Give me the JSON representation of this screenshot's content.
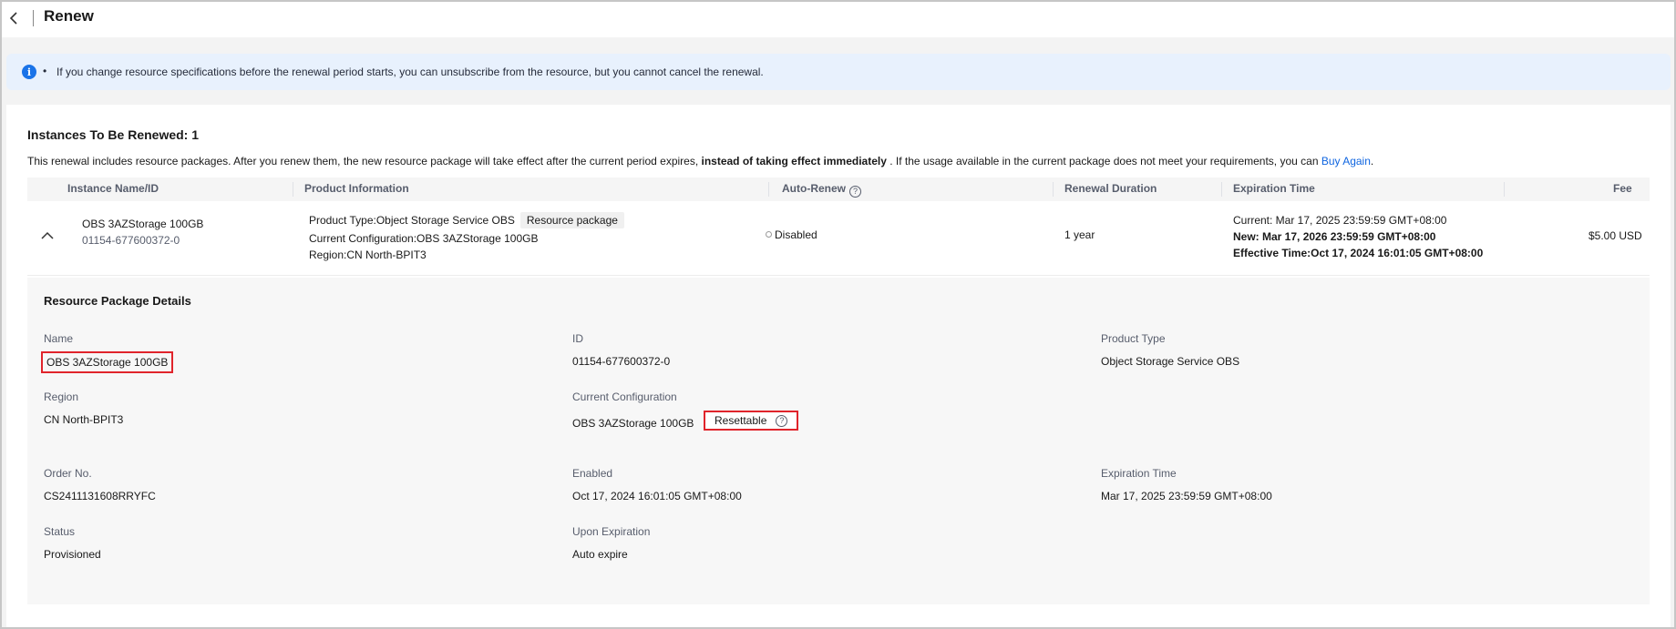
{
  "header": {
    "title": "Renew"
  },
  "alert": {
    "text": "If you change resource specifications before the renewal period starts, you can unsubscribe from the resource, but you cannot cancel the renewal."
  },
  "instances": {
    "title": "Instances To Be Renewed: 1",
    "note_part1": "This renewal includes resource packages. After you renew them, the new resource package will take effect after the current period expires, ",
    "note_bold": "instead of taking effect immediately",
    "note_part2": " . If the usage available in the current package does not meet your requirements, you can ",
    "note_link": "Buy Again",
    "note_end": "."
  },
  "table": {
    "columns": {
      "instance": "Instance Name/ID",
      "product": "Product Information",
      "auto_renew": "Auto-Renew",
      "duration": "Renewal Duration",
      "expiration": "Expiration Time",
      "fee": "Fee"
    },
    "row": {
      "name": "OBS 3AZStorage 100GB",
      "id": "01154-677600372-0",
      "product_type": "Product Type:Object Storage Service OBS",
      "product_tag": "Resource package",
      "current_config": "Current Configuration:OBS 3AZStorage 100GB",
      "region": "Region:CN North-BPIT3",
      "auto_renew": "Disabled",
      "duration": "1 year",
      "exp_current": "Current: Mar 17, 2025 23:59:59 GMT+08:00",
      "exp_new": "New: Mar 17, 2026 23:59:59 GMT+08:00",
      "exp_effective": "Effective Time:Oct 17, 2024 16:01:05 GMT+08:00",
      "fee": "$5.00 USD"
    }
  },
  "details": {
    "title": "Resource Package Details",
    "name_label": "Name",
    "name_value": "OBS 3AZStorage 100GB",
    "id_label": "ID",
    "id_value": "01154-677600372-0",
    "ptype_label": "Product Type",
    "ptype_value": "Object Storage Service OBS",
    "region_label": "Region",
    "region_value": "CN North-BPIT3",
    "config_label": "Current Configuration",
    "config_value": "OBS 3AZStorage 100GB",
    "resettable": "Resettable",
    "order_label": "Order No.",
    "order_value": "CS2411131608RRYFC",
    "enabled_label": "Enabled",
    "enabled_value": "Oct 17, 2024 16:01:05 GMT+08:00",
    "exp_label": "Expiration Time",
    "exp_value": "Mar 17, 2025 23:59:59 GMT+08:00",
    "status_label": "Status",
    "status_value": "Provisioned",
    "upon_label": "Upon Expiration",
    "upon_value": "Auto expire"
  },
  "icons": {
    "back": "chevron-left-icon",
    "info": "info-icon",
    "help": "help-circle-icon",
    "collapse": "chevron-up-icon"
  },
  "colors": {
    "accent": "#0f65e0",
    "alert_bg": "#e8f1fd",
    "highlight": "#e0242b"
  }
}
